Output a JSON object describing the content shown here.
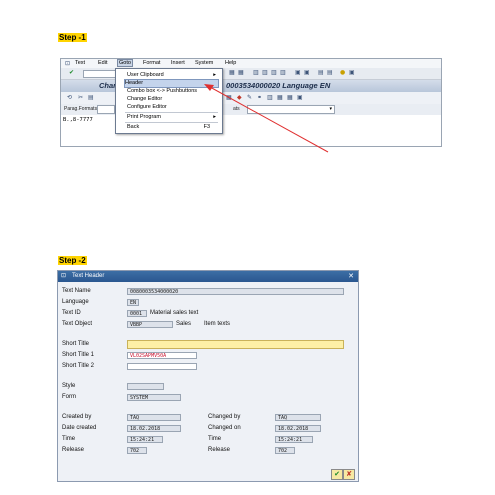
{
  "step1": {
    "label": "Step -1",
    "menubar": [
      "Text",
      "Edit",
      "Goto",
      "Format",
      "Insert",
      "System",
      "Help"
    ],
    "active_menu": "Goto",
    "title": "Chan",
    "title_right": "0003534000020 Language EN",
    "toolbar3": {
      "para_label": "Parag.Formats",
      "char_label": "ats"
    },
    "editor_text": "B.,8-7777",
    "dropdown": {
      "items": [
        {
          "label": "User Clipboard",
          "submenu": true
        },
        {
          "label": "Header",
          "highlight": true
        },
        {
          "label": "Combo box <-> Pushbuttons"
        },
        {
          "label": "Change Editor"
        },
        {
          "label": "Configure Editor"
        },
        {
          "label": "Print Program",
          "submenu": true
        },
        {
          "label": "Back",
          "shortcut": "F3"
        }
      ]
    },
    "arrow_color": "#e03030"
  },
  "step2": {
    "label": "Step -2",
    "dialog_title": "Text Header",
    "fields": {
      "text_name": {
        "label": "Text Name",
        "value": "0080003534000020"
      },
      "language": {
        "label": "Language",
        "value": "EN"
      },
      "text_id": {
        "label": "Text ID",
        "value": "0001",
        "desc": "Material sales text"
      },
      "text_object": {
        "label": "Text Object",
        "value": "VBBP",
        "desc1": "Sales",
        "desc2": "Item texts"
      },
      "short_title": {
        "label": "Short Title",
        "value": ""
      },
      "short_title1": {
        "label": "Short Title 1",
        "value": "VL02SAPMV50A"
      },
      "short_title2": {
        "label": "Short Title 2",
        "value": ""
      },
      "style": {
        "label": "Style",
        "value": ""
      },
      "form": {
        "label": "Form",
        "value": "SYSTEM"
      },
      "created_by": {
        "label": "Created by",
        "value": "TAQ"
      },
      "date_created": {
        "label": "Date created",
        "value": "18.02.2018"
      },
      "time_left": {
        "label": "Time",
        "value": "15:24:21"
      },
      "release_left": {
        "label": "Release",
        "value": "702"
      },
      "changed_by": {
        "label": "Changed by",
        "value": "TAQ"
      },
      "changed_on": {
        "label": "Changed on",
        "value": "18.02.2018"
      },
      "time_right": {
        "label": "Time",
        "value": "15:24:21"
      },
      "release_right": {
        "label": "Release",
        "value": "702"
      }
    },
    "buttons": {
      "ok": "✔",
      "cancel": "✘"
    }
  },
  "colors": {
    "step_highlight": "#ffd400",
    "titlebar": "#2a5790",
    "short_title_bg": "#fdf0a6"
  }
}
